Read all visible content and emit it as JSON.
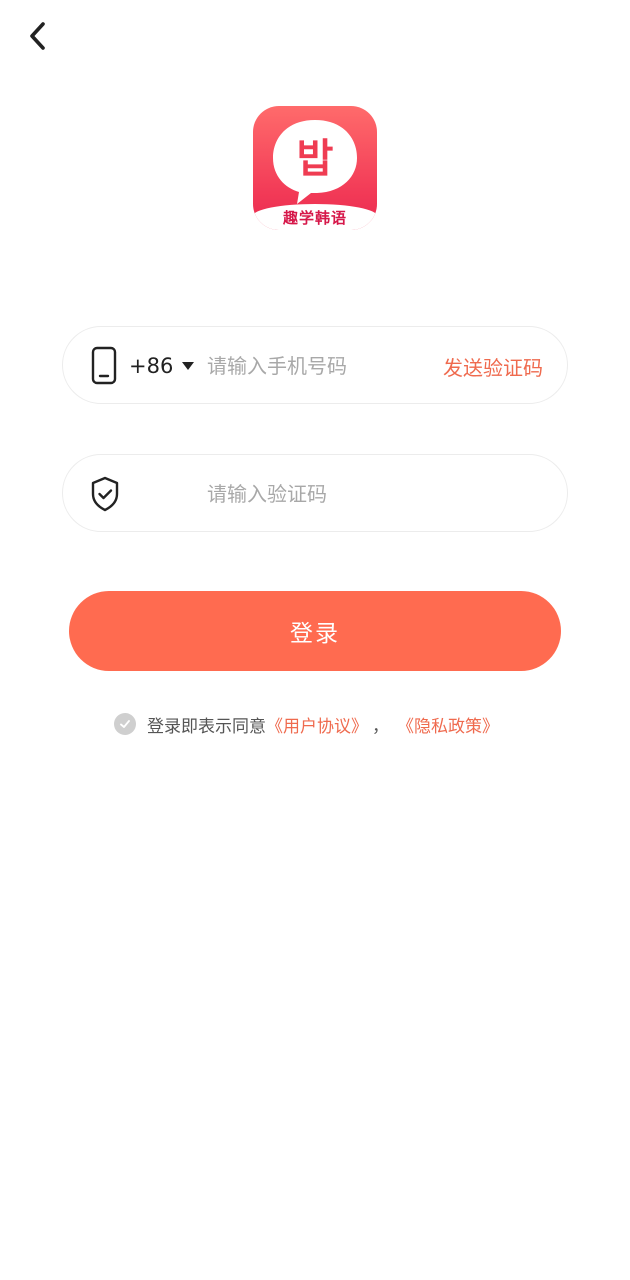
{
  "header": {
    "back_icon": "chevron-left-icon"
  },
  "logo": {
    "glyph": "밥",
    "caption": "趣学韩语",
    "colors": {
      "top": "#ff6b6b",
      "bottom": "#e92a4f",
      "caption": "#d6184a"
    }
  },
  "phone_field": {
    "icon": "phone-icon",
    "country_code": "+86",
    "placeholder": "请输入手机号码",
    "value": "",
    "send_code_label": "发送验证码"
  },
  "code_field": {
    "icon": "shield-check-icon",
    "placeholder": "请输入验证码",
    "value": ""
  },
  "login_button": {
    "label": "登录",
    "color": "#ff6b50"
  },
  "agreement": {
    "prefix": "登录即表示同意",
    "user_agreement": "《用户协议》",
    "separator": "，",
    "privacy_policy": "《隐私政策》",
    "link_color": "#ef6a4e"
  }
}
